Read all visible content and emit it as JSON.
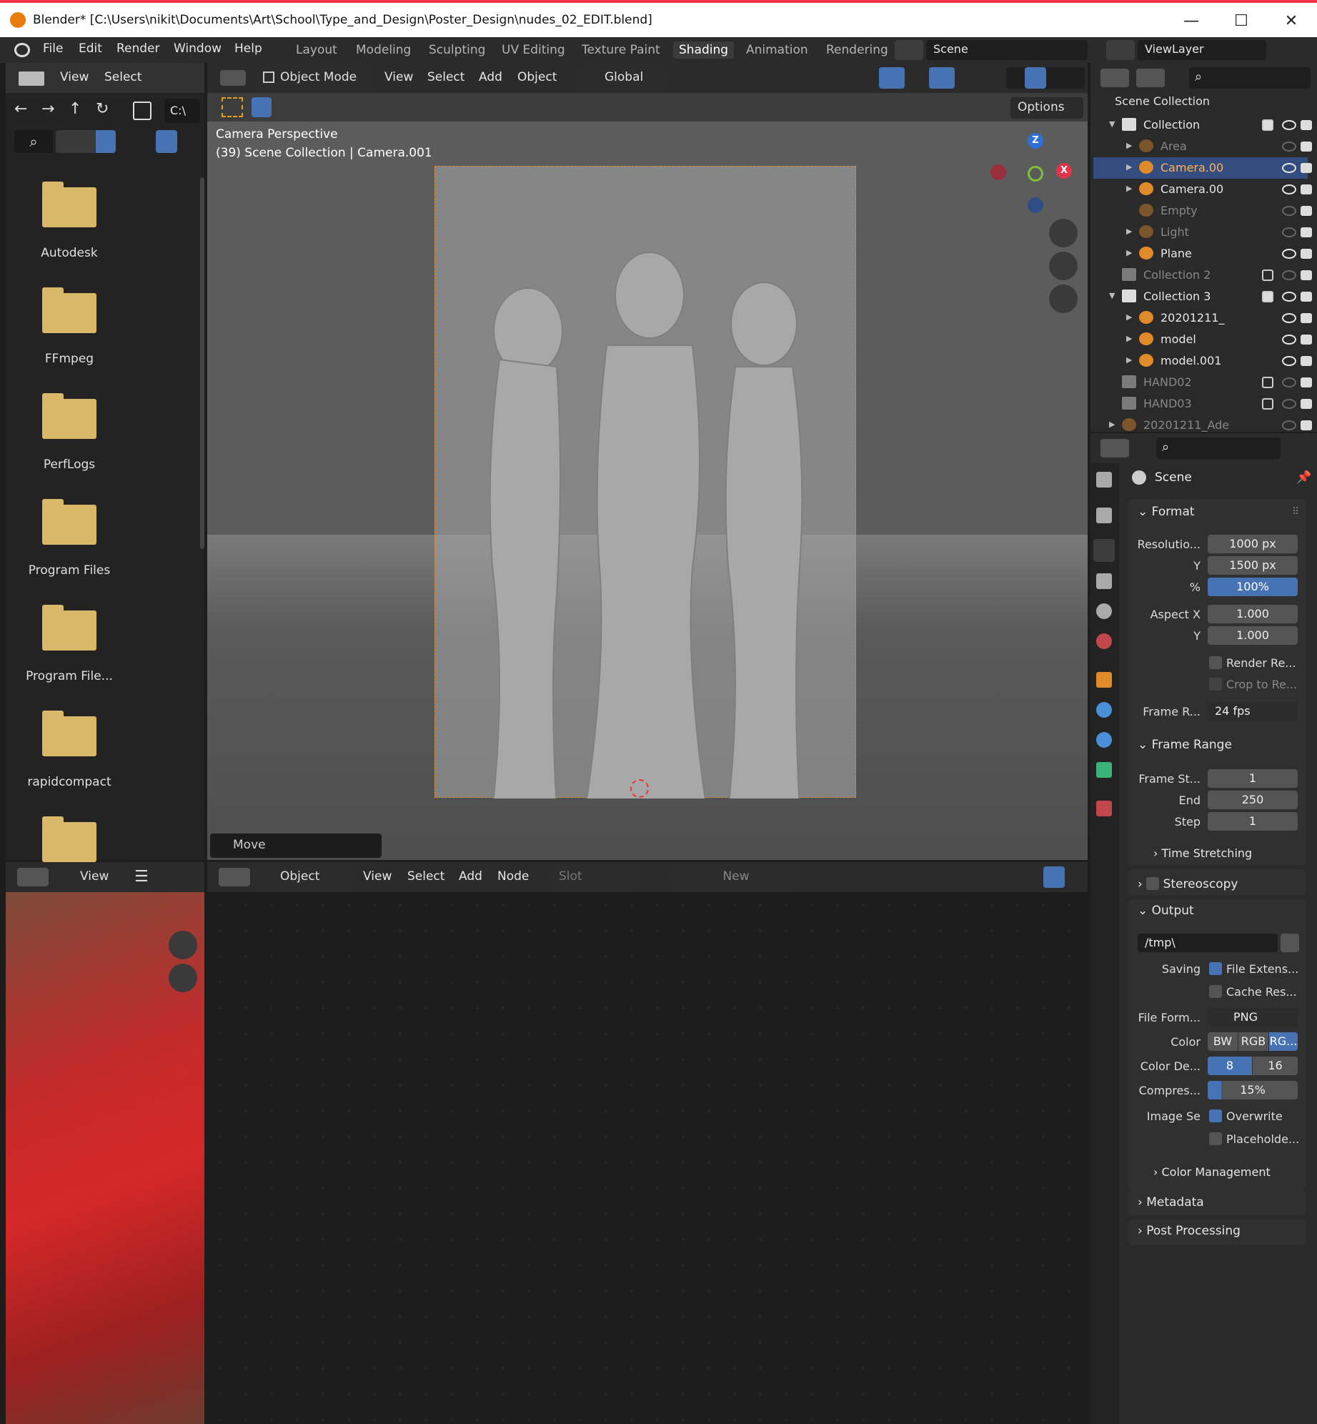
{
  "window": {
    "title": "Blender* [C:\\Users\\nikit\\Documents\\Art\\School\\Type_and_Design\\Poster_Design\\nudes_02_EDIT.blend]",
    "min": "—",
    "max": "☐",
    "close": "✕"
  },
  "menu": [
    "File",
    "Edit",
    "Render",
    "Window",
    "Help"
  ],
  "workspaces": [
    {
      "label": "Layout"
    },
    {
      "label": "Modeling"
    },
    {
      "label": "Sculpting"
    },
    {
      "label": "UV Editing"
    },
    {
      "label": "Texture Paint"
    },
    {
      "label": "Shading",
      "active": true
    },
    {
      "label": "Animation"
    },
    {
      "label": "Rendering"
    }
  ],
  "scene_name": "Scene",
  "view_layer": "ViewLayer",
  "filebrowser": {
    "menu": [
      "View",
      "Select"
    ],
    "path": "C:\\",
    "folders": [
      "Autodesk",
      "FFmpeg",
      "PerfLogs",
      "Program Files",
      "Program File...",
      "rapidcompact",
      ""
    ]
  },
  "viewport": {
    "mode": "Object Mode",
    "menu": [
      "View",
      "Select",
      "Add",
      "Object"
    ],
    "orientation": "Global",
    "options": "Options",
    "info_line1": "Camera Perspective",
    "info_line2": "(39) Scene Collection | Camera.001",
    "last_op": "Move"
  },
  "image_editor": {
    "view": "View"
  },
  "node_editor": {
    "type": "Object",
    "menu": [
      "View",
      "Select",
      "Add",
      "Node"
    ],
    "slot": "Slot",
    "new": "New"
  },
  "outliner": {
    "root": "Scene Collection",
    "rows": [
      {
        "name": "Collection",
        "depth": 0,
        "type": "collection",
        "exp": "▼",
        "chk": true
      },
      {
        "name": "Area",
        "depth": 1,
        "type": "light",
        "exp": "▶",
        "dim": true
      },
      {
        "name": "Camera.00",
        "depth": 1,
        "type": "camera",
        "exp": "▶",
        "selected": true
      },
      {
        "name": "Camera.00",
        "depth": 1,
        "type": "camera",
        "exp": "▶"
      },
      {
        "name": "Empty",
        "depth": 1,
        "type": "empty",
        "exp": "",
        "dim": true
      },
      {
        "name": "Light",
        "depth": 1,
        "type": "light",
        "exp": "▶",
        "dim": true
      },
      {
        "name": "Plane",
        "depth": 1,
        "type": "mesh",
        "exp": "▶"
      },
      {
        "name": "Collection 2",
        "depth": 0,
        "type": "collection",
        "exp": "",
        "dim": true,
        "chk": false
      },
      {
        "name": "Collection 3",
        "depth": 0,
        "type": "collection",
        "exp": "▼",
        "chk": true
      },
      {
        "name": "20201211_",
        "depth": 1,
        "type": "mesh",
        "exp": "▶"
      },
      {
        "name": "model",
        "depth": 1,
        "type": "mesh",
        "exp": "▶"
      },
      {
        "name": "model.001",
        "depth": 1,
        "type": "mesh",
        "exp": "▶"
      },
      {
        "name": "HAND02",
        "depth": 0,
        "type": "collection",
        "exp": "",
        "dim": true,
        "chk": false
      },
      {
        "name": "HAND03",
        "depth": 0,
        "type": "collection",
        "exp": "",
        "dim": true,
        "chk": false
      },
      {
        "name": "20201211_Ade",
        "depth": 0,
        "type": "mesh",
        "exp": "▶",
        "dim": true
      }
    ]
  },
  "properties": {
    "context": "Scene",
    "format": {
      "title": "Format",
      "res_label": "Resolutio...",
      "res_x": "1000 px",
      "y_label": "Y",
      "res_y": "1500 px",
      "pct_label": "%",
      "pct": "100%",
      "aspect_label": "Aspect X",
      "aspect_x": "1.000",
      "aspect_y": "1.000",
      "render_region": "Render Re...",
      "crop": "Crop to Re...",
      "fr_label": "Frame R...",
      "fps": "24 fps"
    },
    "frame_range": {
      "title": "Frame Range",
      "start_label": "Frame St...",
      "start": "1",
      "end_label": "End",
      "end": "250",
      "step_label": "Step",
      "step": "1",
      "time_stretch": "Time Stretching"
    },
    "stereoscopy": "Stereoscopy",
    "output": {
      "title": "Output",
      "path": "/tmp\\",
      "saving_label": "Saving",
      "file_ext": "File Extens...",
      "cache": "Cache Res...",
      "format_label": "File Form...",
      "format": "PNG",
      "color_label": "Color",
      "color_opts": [
        "BW",
        "RGB",
        "RG..."
      ],
      "depth_label": "Color De...",
      "depth_opts": [
        "8",
        "16"
      ],
      "compress_label": "Compres...",
      "compress": "15%",
      "image_seq_label": "Image Se",
      "overwrite": "Overwrite",
      "placeholder": "Placeholde...",
      "color_mgmt": "Color Management"
    },
    "metadata": "Metadata",
    "post": "Post Processing"
  },
  "colors": {
    "accent": "#4772b3",
    "selected": "#334d80",
    "folder": "#d9b869",
    "bg": "#2a2a2a"
  }
}
